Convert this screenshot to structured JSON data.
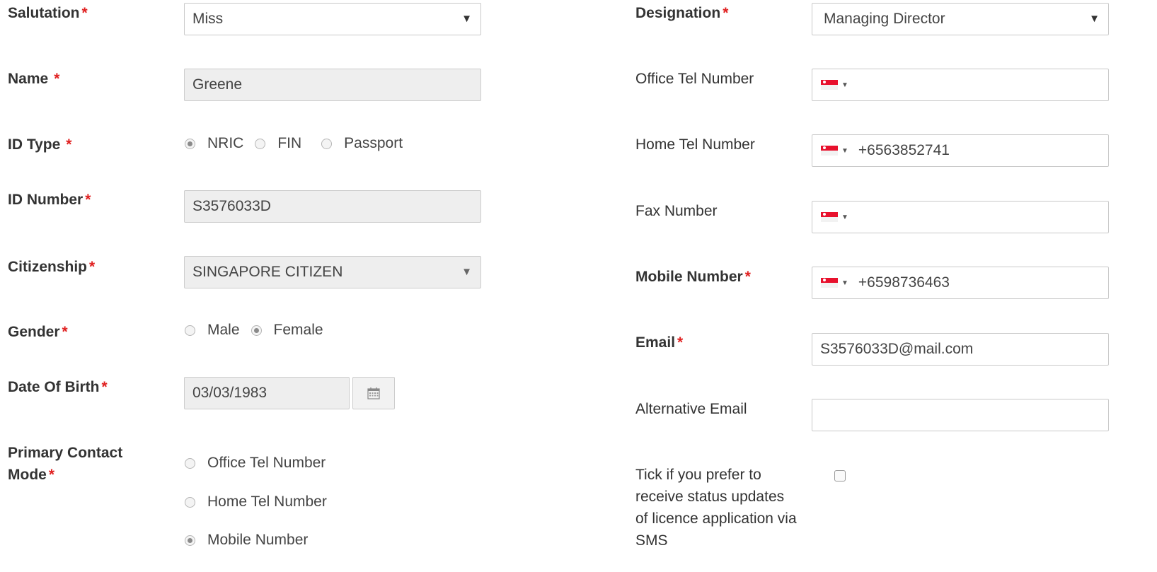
{
  "left": {
    "salutation": {
      "label": "Salutation",
      "value": "Miss"
    },
    "name": {
      "label": "Name",
      "value": "Greene"
    },
    "id_type": {
      "label": "ID Type",
      "options": [
        "NRIC",
        "FIN",
        "Passport"
      ],
      "selected": "NRIC"
    },
    "id_number": {
      "label": "ID Number",
      "value": "S3576033D"
    },
    "citizenship": {
      "label": "Citizenship",
      "value": "SINGAPORE CITIZEN"
    },
    "gender": {
      "label": "Gender",
      "options": [
        "Male",
        "Female"
      ],
      "selected": "Female"
    },
    "dob": {
      "label": "Date Of Birth",
      "value": "03/03/1983"
    },
    "primary_contact": {
      "label_line1": "Primary Contact",
      "label_line2": "Mode",
      "options": [
        "Office Tel Number",
        "Home Tel Number",
        "Mobile Number"
      ],
      "selected": "Mobile Number"
    }
  },
  "right": {
    "designation": {
      "label": "Designation",
      "value": "Managing Director"
    },
    "office_tel": {
      "label": "Office Tel Number",
      "value": ""
    },
    "home_tel": {
      "label": "Home Tel Number",
      "value": "+6563852741"
    },
    "fax": {
      "label": "Fax Number",
      "value": ""
    },
    "mobile": {
      "label": "Mobile Number",
      "value": "+6598736463"
    },
    "email": {
      "label": "Email",
      "value": "S3576033D@mail.com"
    },
    "alt_email": {
      "label": "Alternative Email",
      "value": ""
    },
    "sms_pref": {
      "lines": [
        "Tick if you prefer to",
        "receive status updates",
        "of licence application via",
        "SMS"
      ],
      "checked": false
    }
  },
  "required_mark": "*",
  "colors": {
    "required": "#e02020",
    "readonly_bg": "#eeeeee",
    "flag_red": "#e8112d"
  },
  "icons": {
    "select_caret": "▼",
    "calendar": "calendar-icon",
    "flag": "singapore-flag-icon"
  }
}
